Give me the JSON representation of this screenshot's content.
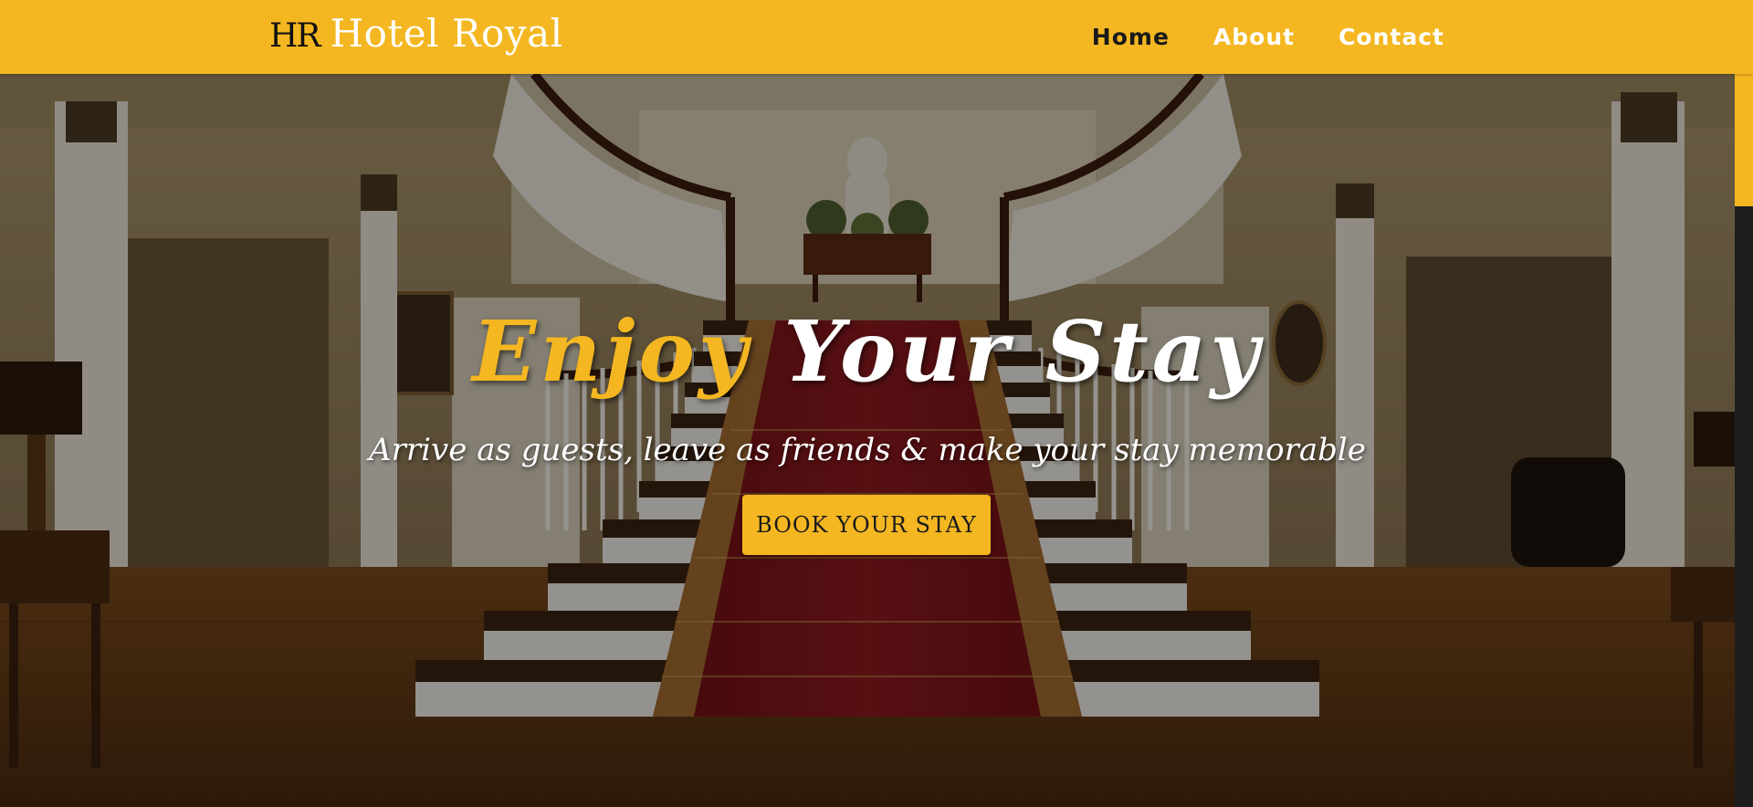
{
  "brand": {
    "mark": "HR",
    "name": "Hotel Royal"
  },
  "nav": {
    "items": [
      {
        "label": "Home",
        "active": true
      },
      {
        "label": "About",
        "active": false
      },
      {
        "label": "Contact",
        "active": false
      }
    ]
  },
  "hero": {
    "title_accent": "Enjoy",
    "title_rest": "Your Stay",
    "subtitle": "Arrive as guests, leave as friends & make your stay memorable",
    "cta_label": "BOOK YOUR STAY",
    "background_image": "grand-staircase-lobby"
  },
  "colors": {
    "accent": "#f4b721",
    "dark": "#1a1a1a",
    "white": "#ffffff"
  }
}
